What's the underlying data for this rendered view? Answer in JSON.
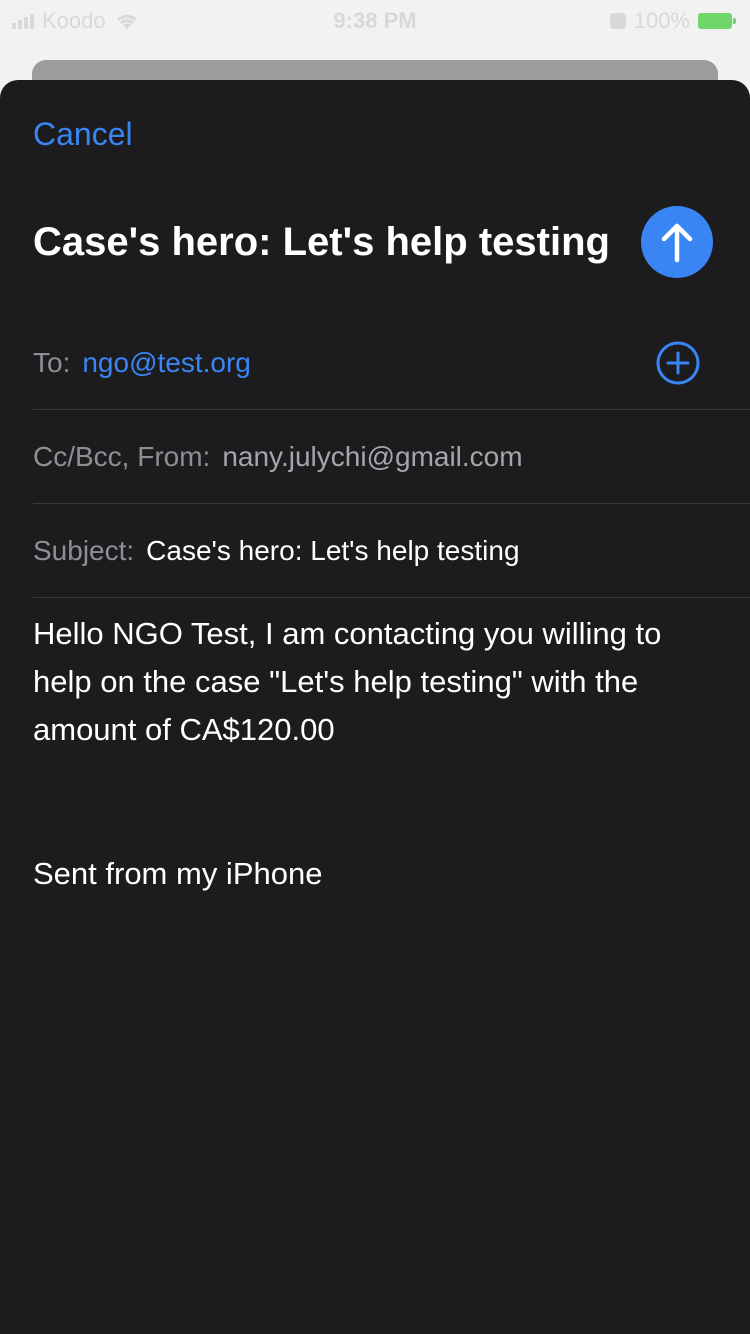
{
  "status_bar": {
    "carrier": "Koodo",
    "time": "9:38 PM",
    "battery": "100%"
  },
  "compose": {
    "cancel_label": "Cancel",
    "title": "Case's hero: Let's help testing",
    "to_label": "To:",
    "to_value": "ngo@test.org",
    "ccbcc_label": "Cc/Bcc, From:",
    "from_value": "nany.julychi@gmail.com",
    "subject_label": "Subject:",
    "subject_value": "Case's hero: Let's help testing",
    "body": "Hello NGO Test, I am contacting you willing to help on the case \"Let's help testing\" with the amount of CA$120.00",
    "signature": "Sent from my iPhone"
  },
  "icons": {
    "send": "arrow-up-icon",
    "add_recipient": "plus-circle-icon",
    "wifi": "wifi-icon",
    "signal": "signal-icon",
    "battery": "battery-icon"
  },
  "colors": {
    "accent": "#3a85f4",
    "sheet_bg": "#1c1c1e",
    "label": "#8e8e93",
    "battery": "#6fd66a"
  }
}
